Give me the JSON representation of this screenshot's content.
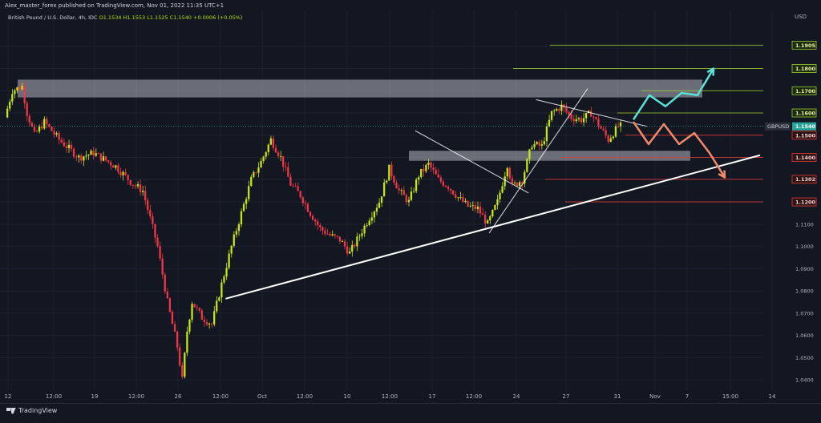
{
  "header": {
    "published": "Alex_master_forex published on TradingView.com, Nov 01, 2022 11:35 UTC+1"
  },
  "symbol_bar": {
    "name": "British Pound / U.S. Dollar, 4h, IDC",
    "ohlc": "O1.1534 H1.1553 L1.1525 C1.1540 +0.0006 (+0.05%)"
  },
  "currency": "USD",
  "footer": {
    "brand": "TradingView"
  },
  "colors": {
    "background": "#131722",
    "bull": "#c8e614",
    "bear": "#f23645",
    "zone": "#b2b5be",
    "trendline": "#ffffff",
    "level_green": "#9ccc30",
    "level_red": "#e53935",
    "arrow_up": "#5ce1d6",
    "arrow_down": "#f08a6a"
  },
  "chart_data": {
    "type": "candlestick",
    "symbol": "GBPUSD",
    "timeframe": "4h",
    "x_tick_labels": [
      "12",
      "12:00",
      "19",
      "12:00",
      "26",
      "12:00",
      "Oct",
      "12:00",
      "10",
      "12:00",
      "17",
      "12:00",
      "24",
      "27",
      "31",
      "Nov",
      "7",
      "15:00",
      "14"
    ],
    "ylim": [
      1.035,
      1.2
    ],
    "y_ticks": [
      1.04,
      1.05,
      1.06,
      1.07,
      1.08,
      1.09,
      1.1,
      1.11,
      1.12,
      1.13,
      1.14,
      1.15,
      1.16,
      1.17,
      1.18,
      1.19
    ],
    "y_tick_labels": [
      "1.0400",
      "1.0500",
      "1.0600",
      "1.0700",
      "1.0800",
      "1.0900",
      "1.1000",
      "1.1100",
      "1.1200",
      "1.1300",
      "1.1400",
      "1.1500",
      "1.1600",
      "1.1700",
      "1.1800",
      "1.1900"
    ],
    "last_price": {
      "label": "GBPUSD",
      "value": "1.1540"
    },
    "levels": [
      {
        "price": 1.1905,
        "label": "1.1905",
        "color": "green"
      },
      {
        "price": 1.18,
        "label": "1.1800",
        "color": "green"
      },
      {
        "price": 1.17,
        "label": "1.1700",
        "color": "green"
      },
      {
        "price": 1.16,
        "label": "1.1600",
        "color": "green"
      },
      {
        "price": 1.15,
        "label": "1.1500",
        "color": "red"
      },
      {
        "price": 1.14,
        "label": "1.1400",
        "color": "red"
      },
      {
        "price": 1.1302,
        "label": "1.1302",
        "color": "red"
      },
      {
        "price": 1.12,
        "label": "1.1200",
        "color": "red"
      }
    ],
    "zones": [
      {
        "from": 1.167,
        "to": 1.175
      },
      {
        "from": 1.1385,
        "to": 1.143
      }
    ],
    "path": [
      [
        0,
        1.158
      ],
      [
        3,
        1.17
      ],
      [
        7,
        1.172
      ],
      [
        9,
        1.16
      ],
      [
        12,
        1.15
      ],
      [
        16,
        1.156
      ],
      [
        22,
        1.148
      ],
      [
        30,
        1.14
      ],
      [
        36,
        1.142
      ],
      [
        45,
        1.136
      ],
      [
        52,
        1.128
      ],
      [
        56,
        1.125
      ],
      [
        62,
        1.1
      ],
      [
        66,
        1.075
      ],
      [
        70,
        1.055
      ],
      [
        72,
        1.04
      ],
      [
        74,
        1.062
      ],
      [
        76,
        1.075
      ],
      [
        80,
        1.068
      ],
      [
        84,
        1.065
      ],
      [
        88,
        1.083
      ],
      [
        92,
        1.1
      ],
      [
        96,
        1.115
      ],
      [
        100,
        1.13
      ],
      [
        104,
        1.138
      ],
      [
        108,
        1.148
      ],
      [
        112,
        1.14
      ],
      [
        116,
        1.128
      ],
      [
        120,
        1.123
      ],
      [
        124,
        1.115
      ],
      [
        128,
        1.108
      ],
      [
        132,
        1.105
      ],
      [
        136,
        1.103
      ],
      [
        140,
        1.097
      ],
      [
        144,
        1.105
      ],
      [
        148,
        1.113
      ],
      [
        152,
        1.12
      ],
      [
        156,
        1.135
      ],
      [
        160,
        1.125
      ],
      [
        164,
        1.12
      ],
      [
        168,
        1.132
      ],
      [
        172,
        1.137
      ],
      [
        176,
        1.13
      ],
      [
        180,
        1.127
      ],
      [
        184,
        1.122
      ],
      [
        188,
        1.118
      ],
      [
        192,
        1.117
      ],
      [
        196,
        1.11
      ],
      [
        200,
        1.12
      ],
      [
        204,
        1.137
      ],
      [
        206,
        1.127
      ],
      [
        210,
        1.13
      ],
      [
        214,
        1.146
      ],
      [
        218,
        1.145
      ],
      [
        222,
        1.16
      ],
      [
        226,
        1.163
      ],
      [
        230,
        1.158
      ],
      [
        234,
        1.157
      ],
      [
        238,
        1.16
      ],
      [
        242,
        1.153
      ],
      [
        245,
        1.148
      ],
      [
        249,
        1.154
      ]
    ],
    "trendlines": [
      {
        "from": [
          89,
          1.0765
        ],
        "to": [
          306,
          1.141
        ]
      },
      {
        "from": [
          166,
          1.152
        ],
        "to": [
          212,
          1.124
        ]
      },
      {
        "from": [
          196,
          1.106
        ],
        "to": [
          236,
          1.171
        ]
      },
      {
        "from": [
          215,
          1.166
        ],
        "to": [
          260,
          1.154
        ]
      }
    ],
    "projections": [
      {
        "direction": "up",
        "points": [
          [
            245,
            1.157
          ],
          [
            251,
            1.168
          ],
          [
            256,
            1.163
          ],
          [
            262,
            1.169
          ],
          [
            268,
            1.168
          ],
          [
            274,
            1.18
          ]
        ]
      },
      {
        "direction": "down",
        "points": [
          [
            245,
            1.156
          ],
          [
            250,
            1.146
          ],
          [
            255,
            1.155
          ],
          [
            260,
            1.146
          ],
          [
            265,
            1.151
          ],
          [
            270,
            1.142
          ],
          [
            276,
            1.131
          ]
        ]
      }
    ]
  }
}
